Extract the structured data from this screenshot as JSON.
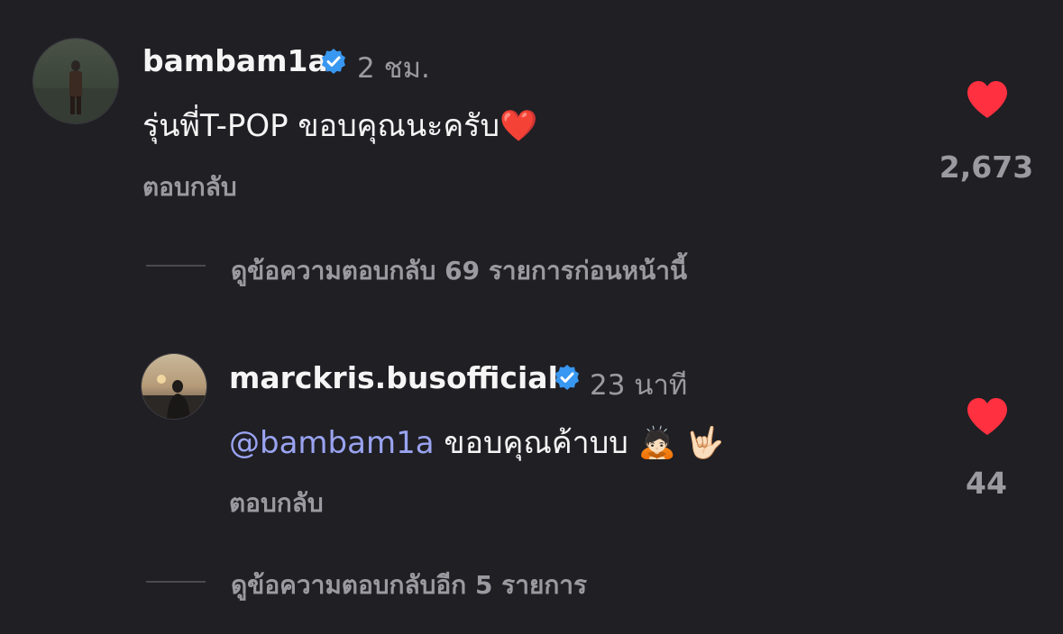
{
  "comments": [
    {
      "username": "bambam1a",
      "timestamp": "2 ชม.",
      "text": "รุ่นพี่T-POP ขอบคุณนะครับ",
      "text_emoji": "❤️",
      "reply_label": "ตอบกลับ",
      "like_count": "2,673",
      "view_replies": "ดูข้อความตอบกลับ 69 รายการก่อนหน้านี้"
    },
    {
      "username": "marckris.busofficial",
      "timestamp": "23 นาที",
      "mention": "@bambam1a",
      "text": "ขอบคุณค้าบบ",
      "text_emoji": "🙇🏻 🤟🏻",
      "reply_label": "ตอบกลับ",
      "like_count": "44",
      "view_replies": "ดูข้อความตอบกลับอีก 5 รายการ"
    }
  ],
  "colors": {
    "background": "#1f1f24",
    "verified": "#3897f0",
    "like": "#ff3040",
    "mention": "#9aa3f0",
    "muted": "#9a9aa0"
  },
  "icons": {
    "verified": "verified-badge-icon",
    "like": "heart-icon"
  }
}
